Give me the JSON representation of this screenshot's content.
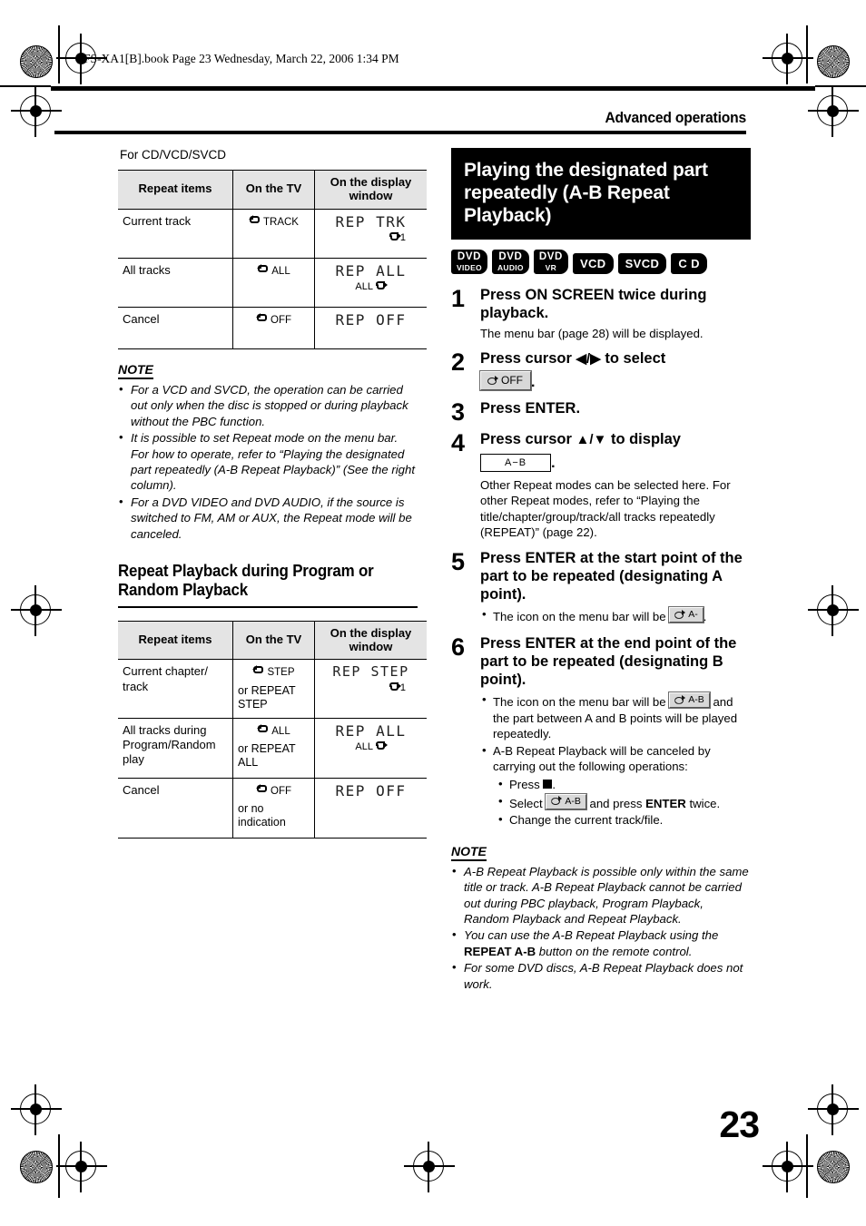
{
  "print_header": {
    "text": "FS-XA1[B].book  Page 23  Wednesday, March 22, 2006  1:34 PM"
  },
  "running_head": {
    "title": "Advanced operations"
  },
  "folio": {
    "page_number": "23"
  },
  "left_column": {
    "intro": "For CD/VCD/SVCD",
    "table_cd": {
      "headers": [
        "Repeat items",
        "On the TV",
        "On the display window"
      ],
      "rows": [
        {
          "item": "Current track",
          "tv_main": "TRACK",
          "tv_sub": "",
          "display_line1": "REP TRK",
          "display_line2": "1",
          "display_line2_align": "right"
        },
        {
          "item": "All tracks",
          "tv_main": "ALL",
          "tv_sub": "",
          "display_line1": "REP ALL",
          "display_line2": "ALL",
          "display_line2_align": "center"
        },
        {
          "item": "Cancel",
          "tv_main": "OFF",
          "tv_sub": "",
          "display_line1": "REP OFF",
          "display_line2": "",
          "display_line2_align": "center"
        }
      ]
    },
    "note": {
      "title": "NOTE",
      "items": [
        "For a VCD and SVCD, the operation can be carried out only when the disc is stopped or during playback without the PBC function.",
        "It is possible to set Repeat mode on the menu bar. For how to operate, refer to “Playing the designated part repeatedly (A-B Repeat Playback)” (See the right column).",
        "For a DVD VIDEO and DVD AUDIO, if the source is switched to FM, AM or AUX, the Repeat mode will be canceled."
      ]
    },
    "subsection": {
      "title": "Repeat Playback during Program or Random Playback"
    },
    "table_program": {
      "headers": [
        "Repeat items",
        "On the TV",
        "On the display window"
      ],
      "rows": [
        {
          "item": "Current chapter/ track",
          "tv_main": "STEP",
          "tv_sub": "or REPEAT STEP",
          "display_line1": "REP STEP",
          "display_line2": "1",
          "display_line2_align": "right"
        },
        {
          "item": "All tracks during Program/Random play",
          "tv_main": "ALL",
          "tv_sub": "or REPEAT ALL",
          "display_line1": "REP ALL",
          "display_line2": "ALL",
          "display_line2_align": "center"
        },
        {
          "item": "Cancel",
          "tv_main": "OFF",
          "tv_sub": "or no indication",
          "display_line1": "REP OFF",
          "display_line2": "",
          "display_line2_align": "center"
        }
      ]
    }
  },
  "right_column": {
    "section_title": "Playing the designated part repeatedly (A-B Repeat Playback)",
    "disc_badges": [
      {
        "line1": "DVD",
        "line2": "VIDEO"
      },
      {
        "line1": "DVD",
        "line2": "AUDIO"
      },
      {
        "line1": "DVD",
        "line2": "VR"
      },
      {
        "line1": "VCD",
        "line2": ""
      },
      {
        "line1": "SVCD",
        "line2": ""
      },
      {
        "line1": "C D",
        "line2": ""
      }
    ],
    "steps": [
      {
        "num": "1",
        "title": "Press ON SCREEN twice during playback.",
        "desc": "The menu bar (page 28) will be displayed."
      },
      {
        "num": "2",
        "title_pre": "Press cursor ",
        "title_arrows": "◀/▶",
        "title_post": " to select",
        "chip_label": "OFF",
        "chip_suffix": "."
      },
      {
        "num": "3",
        "title": "Press ENTER."
      },
      {
        "num": "4",
        "title_pre": "Press cursor ",
        "title_arrows": "▲/▼",
        "title_post": " to display",
        "chip_ab_label": "A−B",
        "chip_suffix": ".",
        "desc": "Other Repeat modes can be selected here. For other Repeat modes, refer to “Playing the title/chapter/group/track/all tracks repeatedly (REPEAT)” (page 22)."
      },
      {
        "num": "5",
        "title": "Press ENTER at the start point of the part to be repeated (designating A point).",
        "bullet_pre": "The icon on the menu bar will be ",
        "bullet_chip": "A-",
        "bullet_post": "."
      },
      {
        "num": "6",
        "title": "Press ENTER at the end point of the part to be repeated (designating B point).",
        "bullet1_pre": "The icon on the menu bar will be ",
        "bullet1_chip": "A-B",
        "bullet1_post": " and the part between A and B points will be played repeatedly.",
        "bullet2": "A-B Repeat Playback will be canceled by carrying out the following operations:",
        "sub_bullet1_pre": "Press ",
        "sub_bullet1_post": ".",
        "sub_bullet2_pre": "Select ",
        "sub_bullet2_chip": "A-B",
        "sub_bullet2_mid": " and press ",
        "sub_bullet2_bold": "ENTER",
        "sub_bullet2_post": " twice.",
        "sub_bullet3": "Change the current track/file."
      }
    ],
    "note": {
      "title": "NOTE",
      "items": [
        {
          "text": "A-B Repeat Playback is possible only within the same title or track. A-B Repeat Playback cannot be carried out during PBC playback, Program Playback, Random Playback and Repeat Playback."
        },
        {
          "pre": "You can use the A-B Repeat Playback using the ",
          "bold": "REPEAT A-B",
          "post": " button on the remote control."
        },
        {
          "text": "For some DVD discs, A-B Repeat Playback does not work."
        }
      ]
    }
  },
  "colors": {
    "page_bg": "#ffffff",
    "ink": "#000000",
    "table_header_bg": "#e4e4e4",
    "chip_bg": "#d8d8d8"
  }
}
